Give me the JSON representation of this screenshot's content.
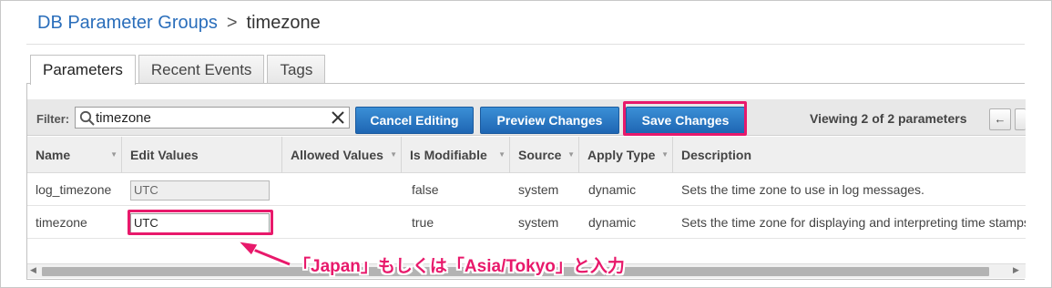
{
  "breadcrumb": {
    "parent": "DB Parameter Groups",
    "separator": ">",
    "current": "timezone"
  },
  "tabs": [
    {
      "label": "Parameters",
      "active": true
    },
    {
      "label": "Recent Events",
      "active": false
    },
    {
      "label": "Tags",
      "active": false
    }
  ],
  "toolbar": {
    "filter_label": "Filter:",
    "filter_value": "timezone",
    "cancel_label": "Cancel Editing",
    "preview_label": "Preview Changes",
    "save_label": "Save Changes",
    "viewing_text": "Viewing 2 of 2 parameters",
    "prev_label": "←"
  },
  "columns": [
    "Name",
    "Edit Values",
    "Allowed Values",
    "Is Modifiable",
    "Source",
    "Apply Type",
    "Description"
  ],
  "rows": [
    {
      "name": "log_timezone",
      "value": "UTC",
      "allowed": "",
      "modifiable": "false",
      "source": "system",
      "apply_type": "dynamic",
      "description": "Sets the time zone to use in log messages."
    },
    {
      "name": "timezone",
      "value": "UTC",
      "allowed": "",
      "modifiable": "true",
      "source": "system",
      "apply_type": "dynamic",
      "description": "Sets the time zone for displaying and interpreting time stamps."
    }
  ],
  "annotation": {
    "text": "「Japan」もしくは「Asia/Tokyo」と入力",
    "color": "#e8196b"
  },
  "colors": {
    "accent": "#2a6ebb",
    "button": "#1e66b3",
    "highlight": "#e8196b"
  }
}
